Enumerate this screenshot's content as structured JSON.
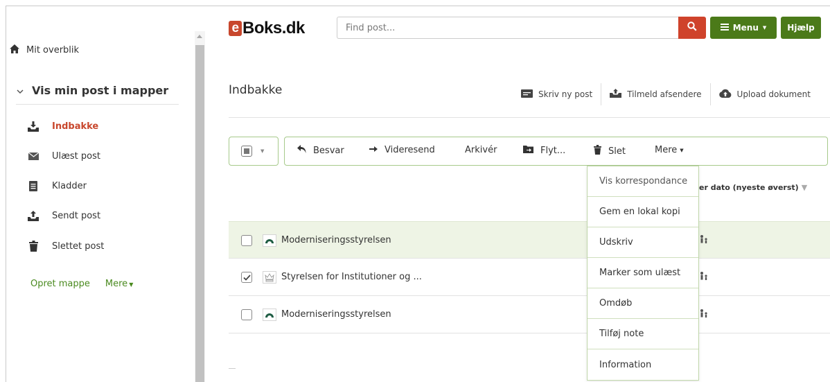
{
  "header": {
    "logo_mark": "e",
    "logo_text": "Boks.dk",
    "search_placeholder": "Find post...",
    "menu_label": "Menu",
    "help_label": "Hjælp"
  },
  "sidebar": {
    "overview_label": "Mit overblik",
    "section_label": "Vis min post i mapper",
    "folders": [
      {
        "label": "Indbakke",
        "icon": "inbox-icon",
        "active": true
      },
      {
        "label": "Ulæst post",
        "icon": "envelope-icon",
        "active": false
      },
      {
        "label": "Kladder",
        "icon": "draft-icon",
        "active": false
      },
      {
        "label": "Sendt post",
        "icon": "outbox-icon",
        "active": false
      },
      {
        "label": "Slettet post",
        "icon": "trash-icon",
        "active": false
      }
    ],
    "create_folder_label": "Opret mappe",
    "more_label": "Mere"
  },
  "main": {
    "title": "Indbakke",
    "actions": [
      {
        "label": "Skriv ny post",
        "icon": "compose-icon"
      },
      {
        "label": "Tilmeld afsendere",
        "icon": "subscribe-icon"
      },
      {
        "label": "Upload dokument",
        "icon": "cloud-upload-icon"
      }
    ],
    "toolbar": {
      "reply_label": "Besvar",
      "forward_label": "Videresend",
      "archive_label": "Arkivér",
      "move_label": "Flyt...",
      "delete_label": "Slet",
      "more_label": "Mere"
    },
    "sort_label": "er dato (nyeste øverst)",
    "messages": [
      {
        "sender": "Moderniseringsstyrelsen",
        "checked": false,
        "highlighted": true,
        "logo": "modst-logo-icon"
      },
      {
        "sender": "Styrelsen for Institutioner og ...",
        "checked": true,
        "highlighted": false,
        "logo": "crown-logo-icon"
      },
      {
        "sender": "Moderniseringsstyrelsen",
        "checked": false,
        "highlighted": false,
        "logo": "modst-logo-icon"
      }
    ]
  },
  "more_menu": {
    "items": [
      "Vis korrespondance",
      "Gem en lokal kopi",
      "Udskriv",
      "Marker som ulæst",
      "Omdøb",
      "Tilføj note",
      "Information"
    ]
  },
  "colors": {
    "brand_red": "#c8472d",
    "brand_green": "#4b7a19",
    "link_green": "#4a8a1f",
    "highlight_row": "#eef4e5",
    "toolbar_border": "#a6c98a"
  }
}
